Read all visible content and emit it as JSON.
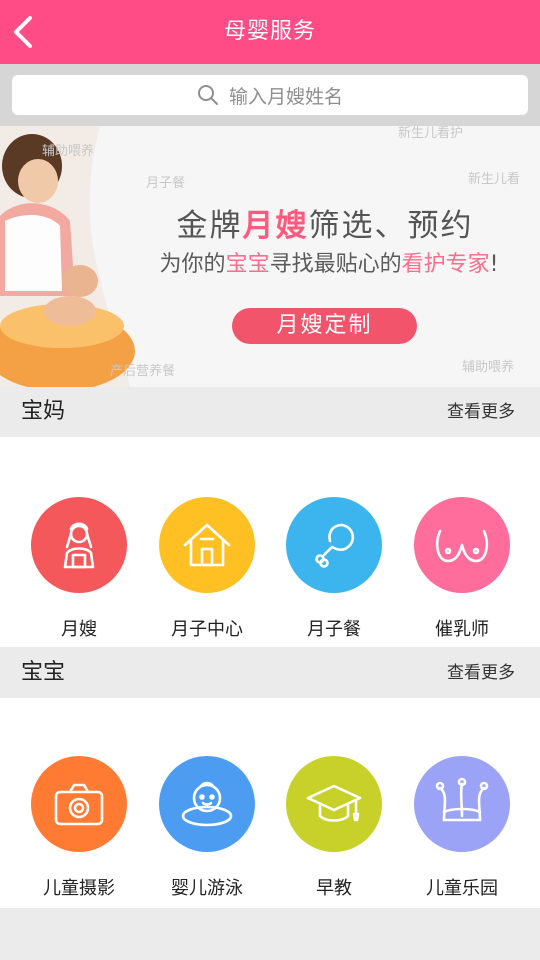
{
  "header": {
    "title": "母婴服务"
  },
  "search": {
    "placeholder": "输入月嫂姓名"
  },
  "banner": {
    "line1_a": "金牌",
    "line1_hl": "月嫂",
    "line1_b": "筛选、预约",
    "line2_a": "为你的",
    "line2_hl1": "宝宝",
    "line2_b": "寻找最贴心的",
    "line2_hl2": "看护专家",
    "line2_c": "!",
    "button": "月嫂定制",
    "watermarks": [
      "新生儿看护",
      "月子餐",
      "新生儿看",
      "辅助喂养",
      "产后营养餐",
      "辅助喂养"
    ]
  },
  "sections": [
    {
      "title": "宝妈",
      "more": "查看更多",
      "items": [
        {
          "label": "月嫂",
          "icon": "nanny-icon",
          "color": "#f5585a"
        },
        {
          "label": "月子中心",
          "icon": "house-icon",
          "color": "#ffc024"
        },
        {
          "label": "月子餐",
          "icon": "drumstick-icon",
          "color": "#3cb5ef"
        },
        {
          "label": "催乳师",
          "icon": "breast-icon",
          "color": "#ff6d9d"
        }
      ]
    },
    {
      "title": "宝宝",
      "more": "查看更多",
      "items": [
        {
          "label": "儿童摄影",
          "icon": "camera-icon",
          "color": "#ff7a32"
        },
        {
          "label": "婴儿游泳",
          "icon": "baby-swim-icon",
          "color": "#4c9df2"
        },
        {
          "label": "早教",
          "icon": "graduation-cap-icon",
          "color": "#c8d12a"
        },
        {
          "label": "儿童乐园",
          "icon": "jester-hat-icon",
          "color": "#9aa3f5"
        }
      ]
    }
  ]
}
